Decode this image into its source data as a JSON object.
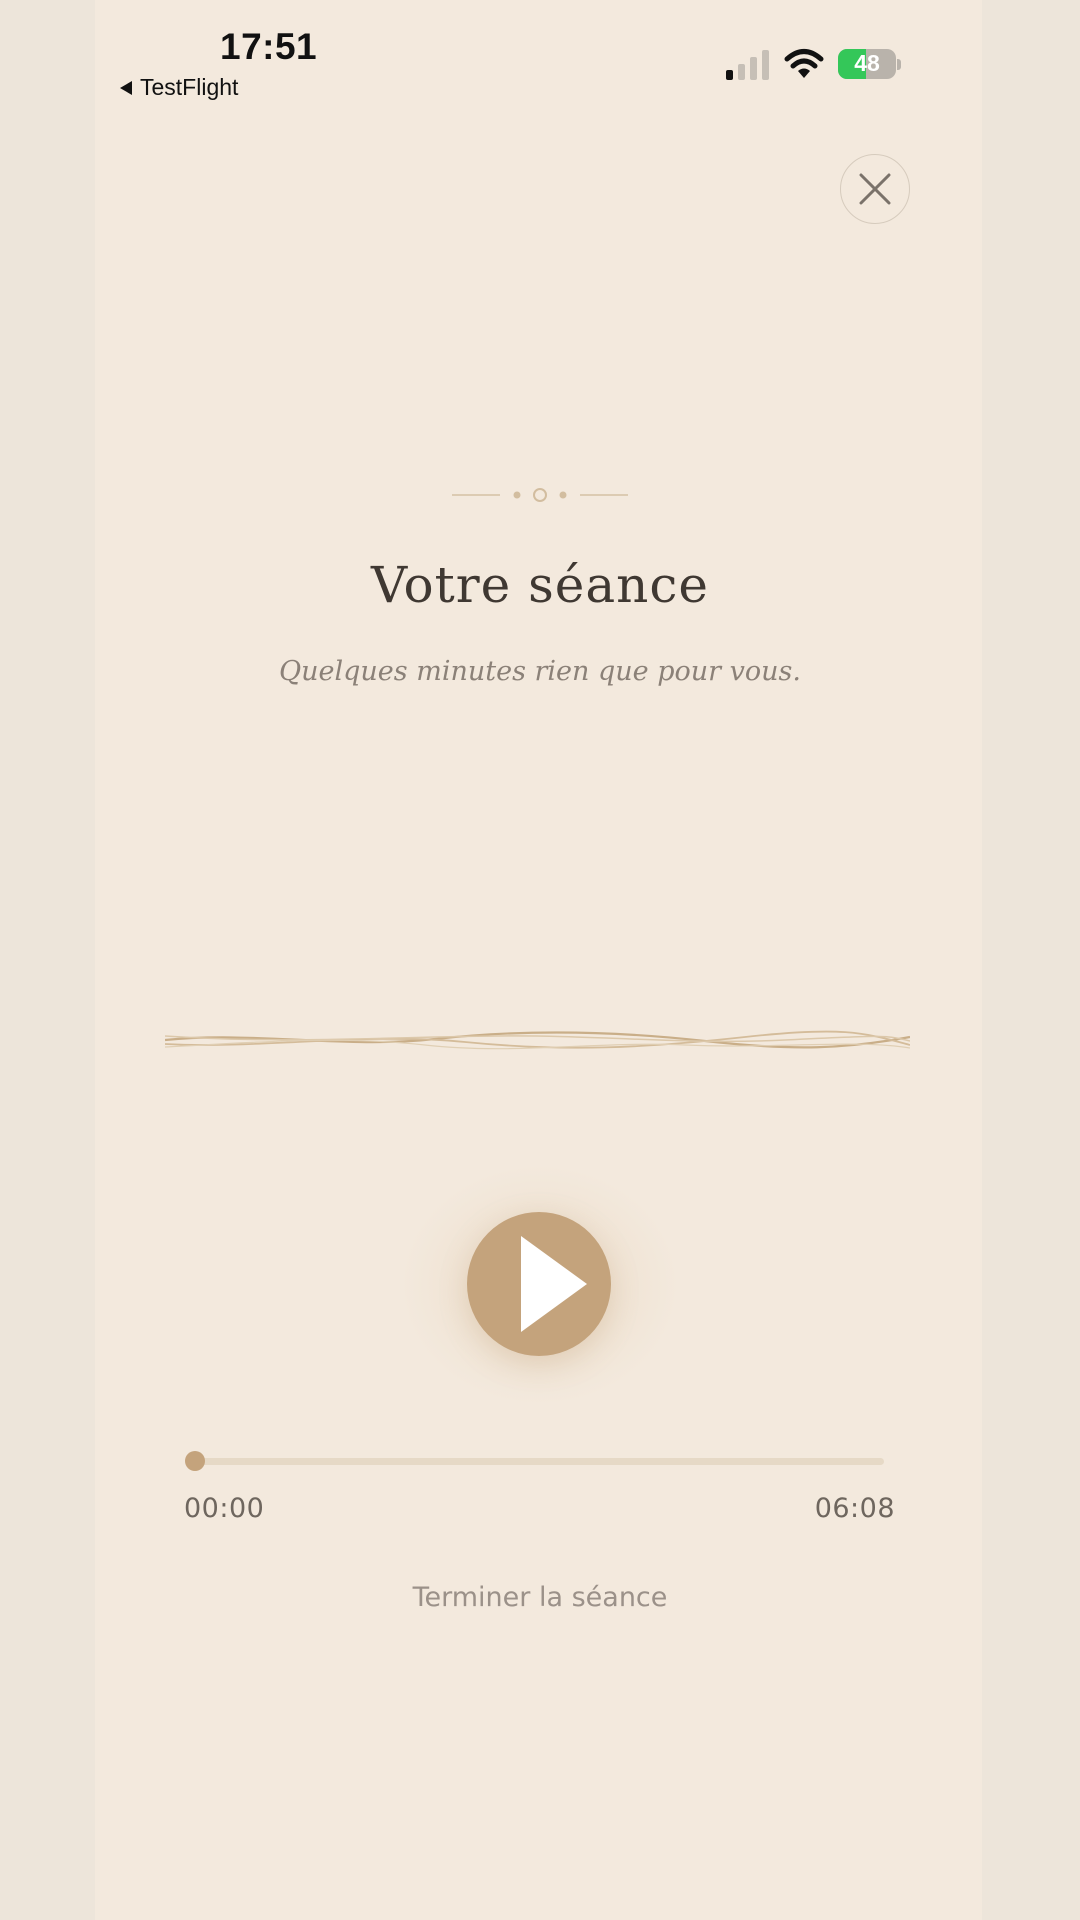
{
  "status_bar": {
    "time": "17:51",
    "back_app": "TestFlight",
    "battery_level": "48",
    "icons": [
      "back-arrow-icon",
      "cellular-signal-icon",
      "wifi-icon",
      "battery-charging-icon"
    ]
  },
  "session": {
    "close_icon": "close-icon",
    "title": "Votre séance",
    "subtitle": "Quelques minutes rien que pour vous.",
    "play_icon": "play-icon"
  },
  "player": {
    "current_time": "00:00",
    "duration": "06:08",
    "progress": 0
  },
  "actions": {
    "finish_label": "Terminer la séance"
  },
  "colors": {
    "background": "#f3e9dd",
    "accent": "#c4a37c",
    "title": "#3f3832"
  }
}
